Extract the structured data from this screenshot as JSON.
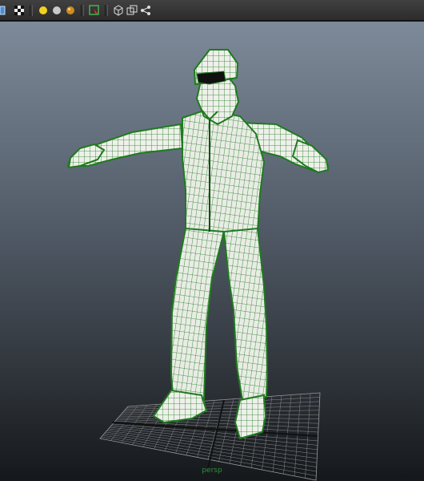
{
  "toolbar": {
    "buttons": [
      {
        "icon": "shaded-cube-icon"
      },
      {
        "icon": "checker-texture-icon"
      },
      {
        "icon": "default-light-icon",
        "color": "#f2d21e"
      },
      {
        "icon": "all-lights-icon",
        "color": "#c9c9c9"
      },
      {
        "icon": "shadow-light-icon",
        "color": "#d18c1a"
      },
      {
        "icon": "isolate-select-icon"
      },
      {
        "icon": "xray-cube-icon"
      },
      {
        "icon": "xray-joints-icon"
      },
      {
        "icon": "share-nodes-icon"
      }
    ]
  },
  "viewport": {
    "camera_label": "persp",
    "mesh_color": "#1f7a1f",
    "mesh_fill": "#eef0ea"
  }
}
